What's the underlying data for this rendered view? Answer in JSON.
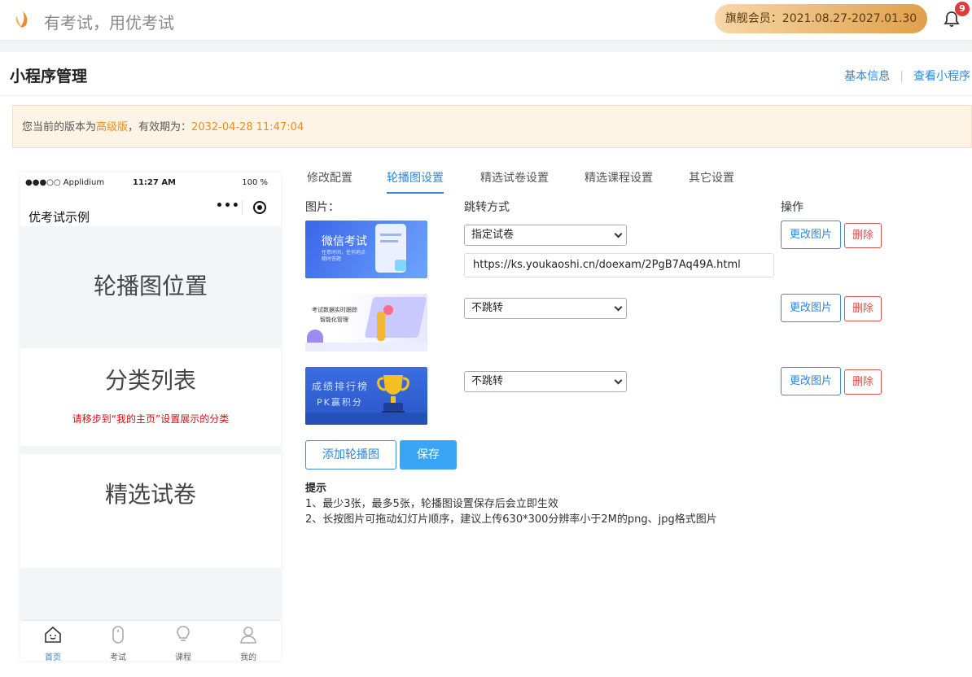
{
  "header": {
    "slogan": "有考试，用优考试",
    "vip_label": "旗舰会员：2021.08.27-2027.01.30",
    "notification_count": "9"
  },
  "page": {
    "title": "小程序管理",
    "links": [
      "基本信息",
      "查看小程序"
    ]
  },
  "notice": {
    "prefix": "您当前的版本为",
    "version": "高级版",
    "mid": "，有效期为：",
    "expire": "2032-04-28 11:47:04"
  },
  "phone": {
    "carrier": "●●●○○ Applidium",
    "time": "11:27 AM",
    "battery": "100 %",
    "app_title": "优考试示例",
    "banner_placeholder": "轮播图位置",
    "category_title": "分类列表",
    "category_tip": "请移步到“我的主页”设置展示的分类",
    "exam_title": "精选试卷",
    "tabs": [
      "首页",
      "考试",
      "课程",
      "我的"
    ]
  },
  "tabs": [
    "修改配置",
    "轮播图设置",
    "精选试卷设置",
    "精选课程设置",
    "其它设置"
  ],
  "active_tab": "轮播图设置",
  "columns": {
    "image": "图片：",
    "jump": "跳转方式",
    "action": "操作"
  },
  "banners": [
    {
      "thumb_text": "微信考试",
      "thumb_sub": "任意时间，任何地点 随时答题",
      "jump": "指定试卷",
      "url": "https://ks.youkaoshi.cn/doexam/2PgB7Aq49A.html"
    },
    {
      "thumb_text": "考试数据实时跟踪",
      "thumb_sub": "智能化管理",
      "jump": "不跳转"
    },
    {
      "thumb_text": "成绩排行榜",
      "thumb_sub": "PK赢积分",
      "jump": "不跳转"
    }
  ],
  "buttons": {
    "change_image": "更改图片",
    "delete": "删除",
    "add_banner": "添加轮播图",
    "save": "保存"
  },
  "hints": {
    "title": "提示",
    "lines": [
      "1、最少3张，最多5张，轮播图设置保存后会立即生效",
      "2、长按图片可拖动幻灯片顺序，建议上传630*300分辨率小于2M的png、jpg格式图片"
    ]
  },
  "colors": {
    "accent": "#2e86de",
    "danger": "#d9534f",
    "vip_gold": "#e0a04a",
    "highlight": "#f08c1c"
  }
}
